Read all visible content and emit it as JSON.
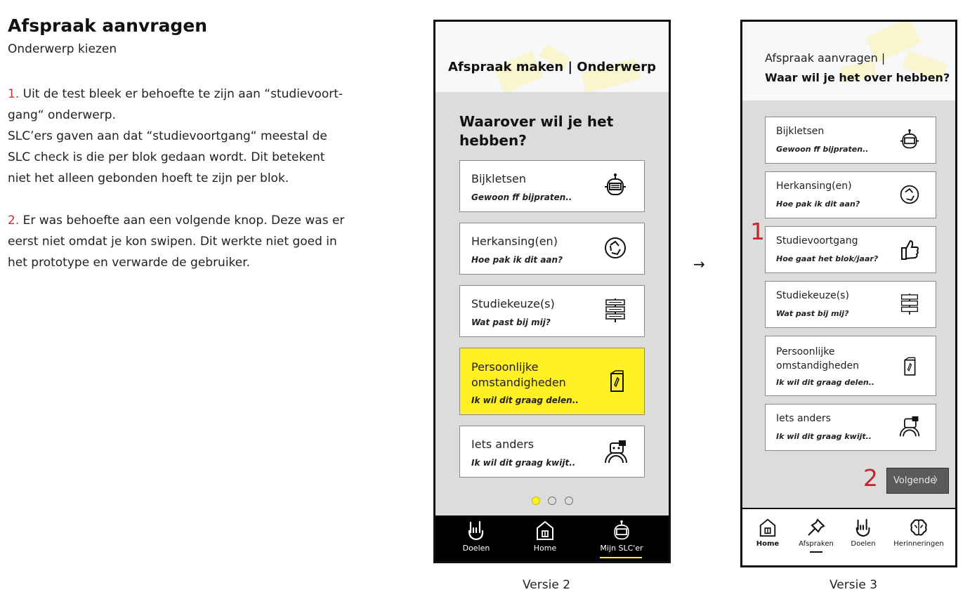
{
  "doc": {
    "title": "Afspraak aanvragen",
    "subtitle": "Onderwerp kiezen",
    "p1_num": "1.",
    "p1_text": " Uit de test bleek er behoefte te zijn aan “studievoort-gang“ onderwerp.",
    "p1_text2": "SLC’ers gaven aan dat “studievoortgang“ meestal de SLC check is die per blok gedaan wordt. Dit betekent niet het alleen gebonden hoeft te zijn per blok.",
    "p2_num": "2.",
    "p2_text": " Er was behoefte aan een volgende knop. Deze was er eerst niet omdat je kon swipen. Dit werkte niet goed in het prototype en verwarde de gebruiker."
  },
  "arrow": "→",
  "v2": {
    "header": "Afspraak maken | Onderwerp",
    "question_line1": "Waarover wil je het",
    "question_line2": "hebben?",
    "cards": [
      {
        "title": "Bijkletsen",
        "sub": "Gewoon ff bijpraten..",
        "icon": "robot-icon"
      },
      {
        "title": "Herkansing(en)",
        "sub": "Hoe pak ik dit aan?",
        "icon": "recycle-icon"
      },
      {
        "title": "Studiekeuze(s)",
        "sub": "Wat past bij mij?",
        "icon": "signpost-icon"
      },
      {
        "title": "Persoonlijke omstandigheden",
        "title_l1": "Persoonlijke",
        "title_l2": "omstandigheden",
        "sub": "Ik wil dit graag delen..",
        "icon": "notebook-icon"
      },
      {
        "title": "Iets anders",
        "sub": "Ik wil dit graag kwijt..",
        "icon": "character-icon"
      }
    ],
    "dots_active": 1,
    "nav": [
      {
        "label": "Doelen",
        "icon": "rock-hand-icon"
      },
      {
        "label": "Home",
        "icon": "house-icon"
      },
      {
        "label": "Mijn SLC'er",
        "icon": "robot-icon"
      }
    ],
    "caption": "Versie 2"
  },
  "v3": {
    "header_line1": "Afspraak aanvragen |",
    "header_line2": "Waar wil je het over hebben?",
    "cards": [
      {
        "title": "Bijkletsen",
        "sub": "Gewoon ff bijpraten..",
        "icon": "robot-icon"
      },
      {
        "title": "Herkansing(en)",
        "sub": "Hoe pak ik dit aan?",
        "icon": "recycle-icon"
      },
      {
        "title": "Studievoortgang",
        "sub": "Hoe gaat het blok/jaar?",
        "icon": "thumbs-up-icon"
      },
      {
        "title": "Studiekeuze(s)",
        "sub": "Wat past bij mij?",
        "icon": "signpost-icon"
      },
      {
        "title_l1": "Persoonlijke",
        "title_l2": "omstandigheden",
        "sub": "Ik wil dit graag delen..",
        "icon": "notebook-icon"
      },
      {
        "title": "Iets anders",
        "sub": "Ik wil dit graag kwijt..",
        "icon": "character-icon"
      }
    ],
    "next_button": "Volgende",
    "next_chevron": "〉",
    "marker1": "1",
    "marker2": "2",
    "nav": [
      {
        "label": "Home",
        "icon": "house-icon"
      },
      {
        "label": "Afspraken",
        "icon": "pin-icon"
      },
      {
        "label": "Doelen",
        "icon": "rock-hand-icon"
      },
      {
        "label": "Herinneringen",
        "icon": "brain-icon"
      }
    ],
    "caption": "Versie 3"
  },
  "colors": {
    "accent_yellow": "#fff023",
    "marker_red": "#c0282d",
    "nav_dark": "#000000",
    "button_gray": "#5a5a5a"
  }
}
